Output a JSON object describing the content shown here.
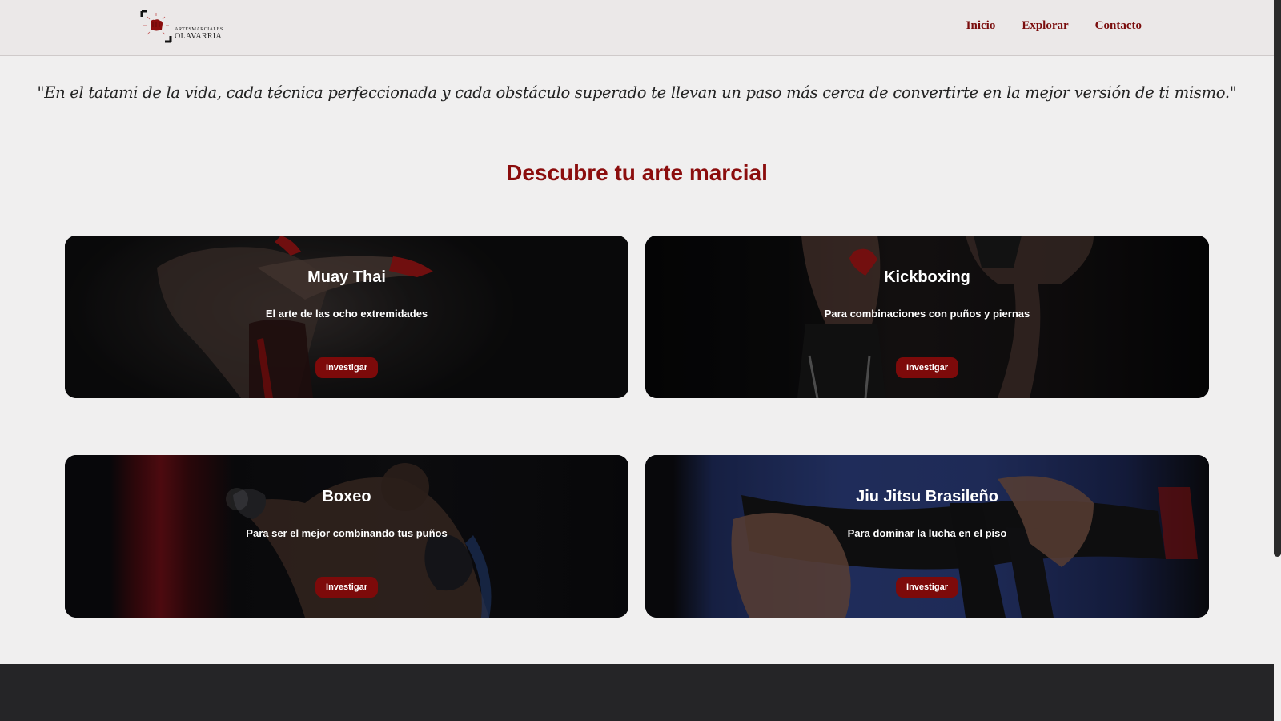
{
  "brand": {
    "line1": "ARTESMARCIALES",
    "line2": "OLAVARRIA"
  },
  "nav": {
    "items": [
      "Inicio",
      "Explorar",
      "Contacto"
    ]
  },
  "quote": "\"En el tatami de la vida, cada técnica perfeccionada y cada obstáculo superado te llevan un paso más cerca de convertirte en la mejor versión de ti mismo.\"",
  "section_title": "Descubre tu arte marcial",
  "cards": [
    {
      "title": "Muay Thai",
      "subtitle": "El arte de las ocho extremidades",
      "button": "Investigar"
    },
    {
      "title": "Kickboxing",
      "subtitle": "Para combinaciones con puños y piernas",
      "button": "Investigar"
    },
    {
      "title": "Boxeo",
      "subtitle": "Para ser el mejor combinando tus puños",
      "button": "Investigar"
    },
    {
      "title": "Jiu Jitsu Brasileño",
      "subtitle": "Para dominar la lucha en el piso",
      "button": "Investigar"
    }
  ],
  "colors": {
    "accent": "#8b0d0d",
    "nav_bg": "#ebe8e8",
    "page_bg": "#f0efef",
    "footer_bg": "#252527",
    "button_bg": "#7d0a0a"
  }
}
